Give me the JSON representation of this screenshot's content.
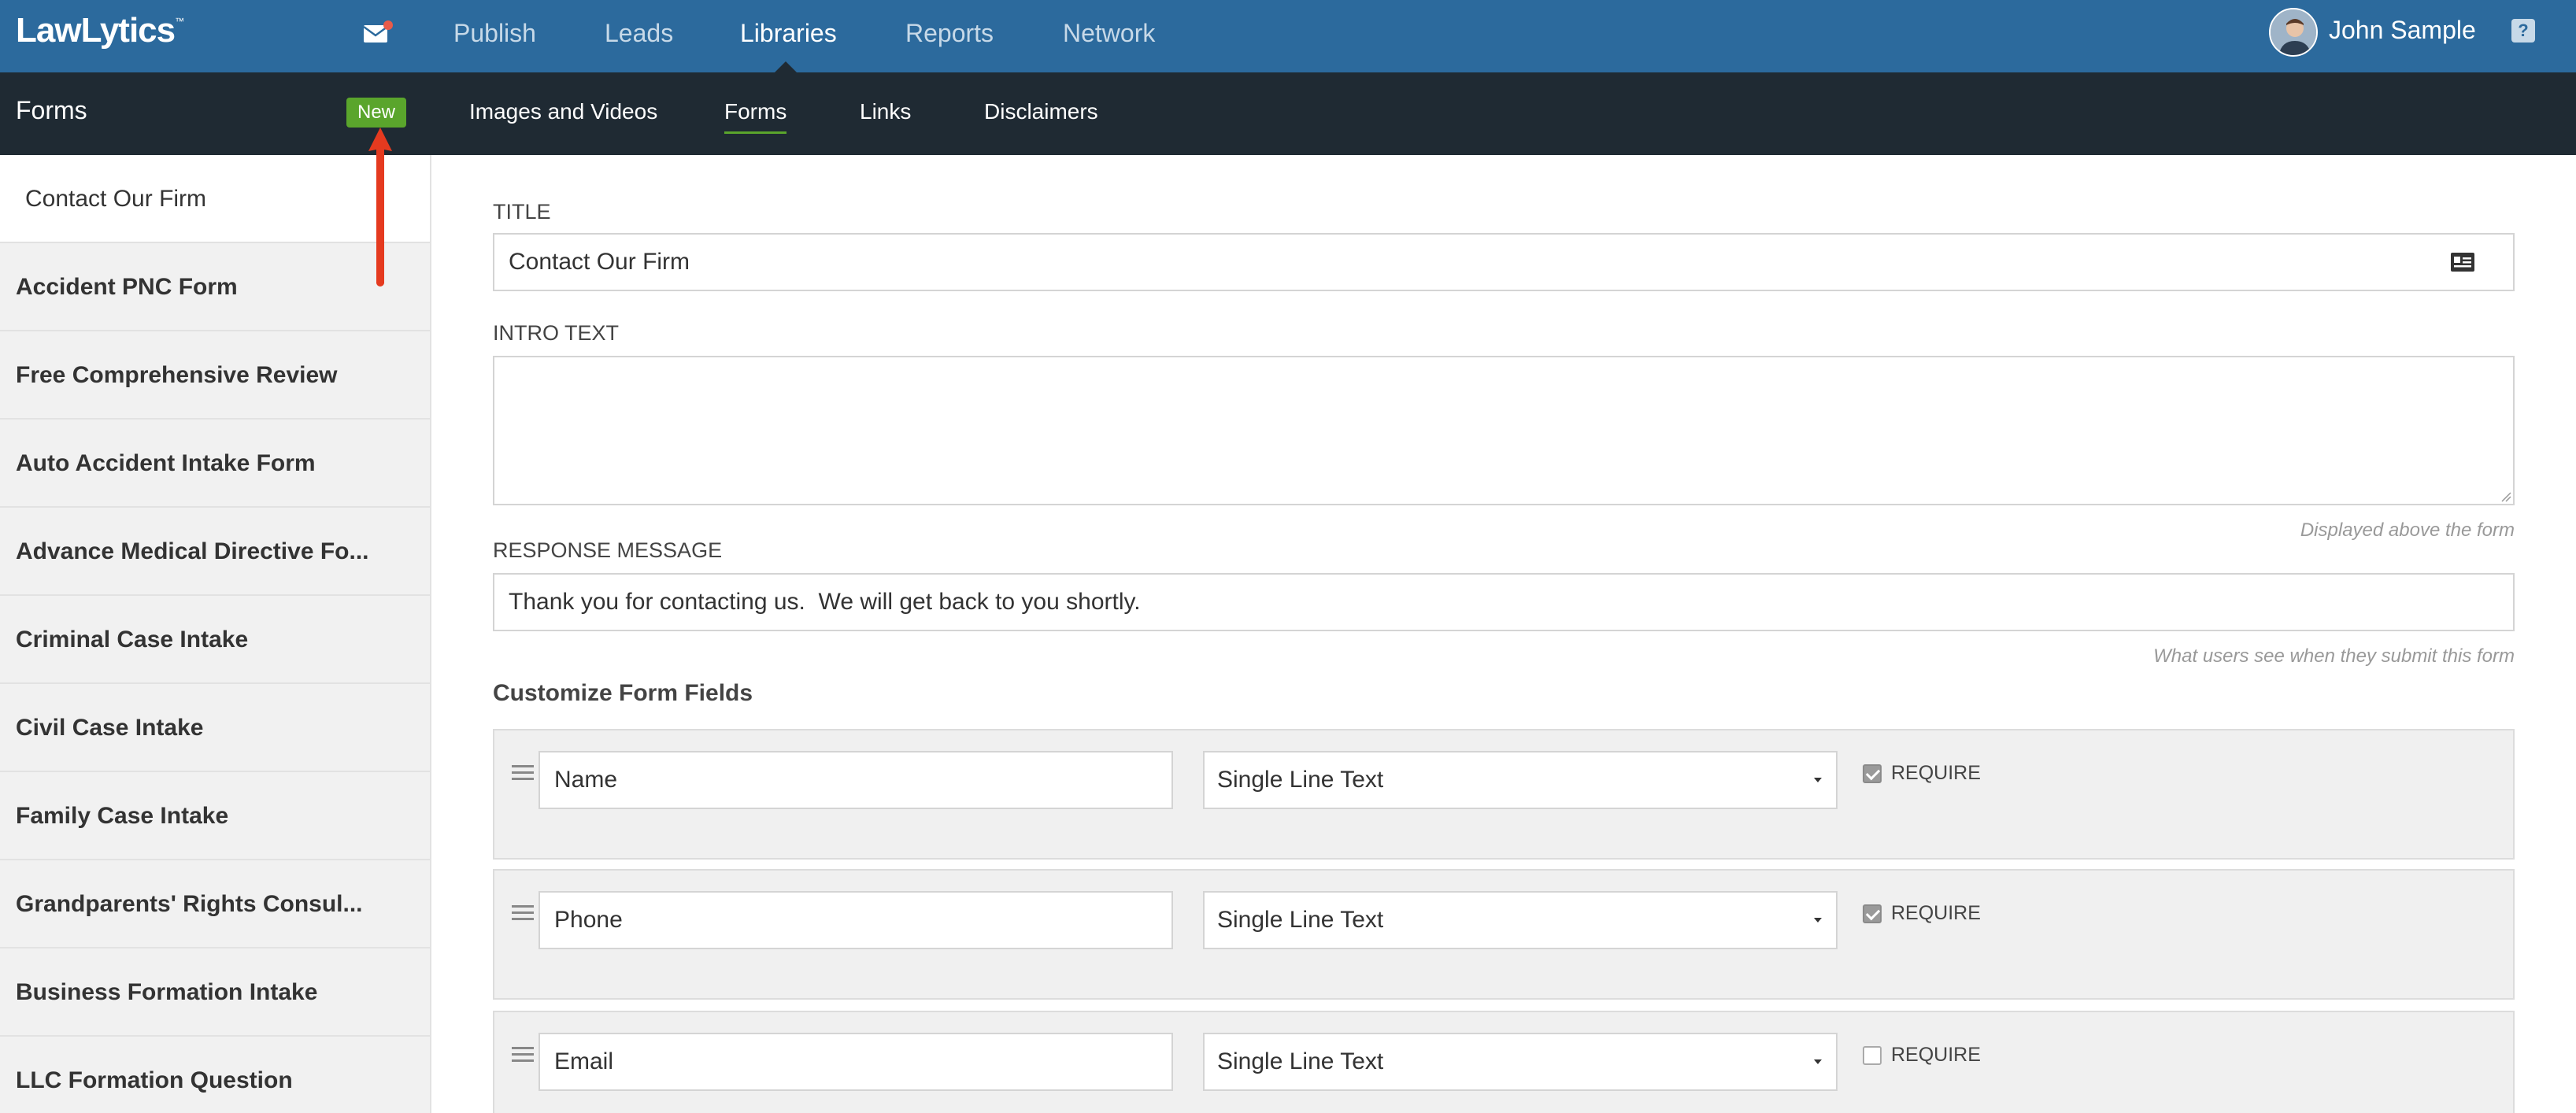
{
  "app": {
    "logo": "LawLytics",
    "logo_tm": "™"
  },
  "topnav": {
    "items": [
      "Publish",
      "Leads",
      "Libraries",
      "Reports",
      "Network"
    ],
    "active": "Libraries"
  },
  "user": {
    "name": "John Sample",
    "help_label": "?"
  },
  "subbar": {
    "title": "Forms",
    "new_button": "New",
    "tabs": [
      "Images and Videos",
      "Forms",
      "Links",
      "Disclaimers"
    ],
    "active_tab": "Forms"
  },
  "sidebar": {
    "items": [
      "Contact Our Firm",
      "Accident PNC Form",
      "Free Comprehensive Review",
      "Auto Accident Intake Form",
      "Advance Medical Directive Fo...",
      "Criminal Case Intake",
      "Civil Case Intake",
      "Family Case Intake",
      "Grandparents' Rights Consul...",
      "Business Formation Intake",
      "LLC Formation Question"
    ],
    "selected": "Contact Our Firm"
  },
  "form": {
    "title_label": "TITLE",
    "title_value": "Contact Our Firm",
    "intro_label": "INTRO TEXT",
    "intro_value": "",
    "intro_help": "Displayed above the form",
    "response_label": "RESPONSE MESSAGE",
    "response_value": "Thank you for contacting us.  We will get back to you shortly.",
    "response_help": "What users see when they submit this form"
  },
  "fields": {
    "section_title": "Customize Form Fields",
    "require_label": "REQUIRE",
    "rows": [
      {
        "name": "Name",
        "type": "Single Line Text",
        "required": true
      },
      {
        "name": "Phone",
        "type": "Single Line Text",
        "required": true
      },
      {
        "name": "Email",
        "type": "Single Line Text",
        "required": false
      }
    ]
  },
  "colors": {
    "topbar": "#2c6a9d",
    "subbar": "#1f2a33",
    "new_button": "#5aa52c",
    "annotation_arrow": "#e53a1f"
  }
}
